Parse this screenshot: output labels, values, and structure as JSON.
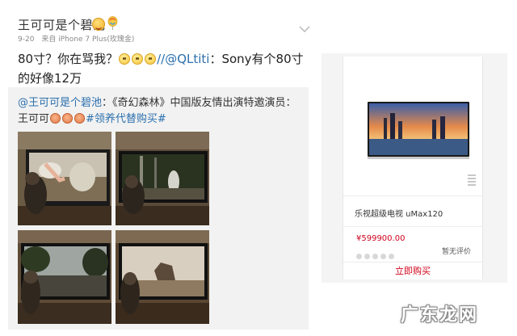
{
  "post": {
    "author": "王可可是个碧池",
    "time": "9-20",
    "source": "来自 iPhone 7 Plus(玫瑰金)",
    "text_before": "80寸？你在骂我？",
    "text_mention": "//@QLtiti",
    "text_after": "：Sony有个80寸的好像12万",
    "quote": {
      "mention": "@王可可是个碧池",
      "text": "：《奇幻森林》中国版友情出演特邀演员：王可可",
      "tag": "#领养代替购买#"
    },
    "thumbnails": [
      {
        "name": "thumb-dog-watching-tv-1"
      },
      {
        "name": "thumb-dog-watching-tv-2"
      },
      {
        "name": "thumb-dog-watching-tv-3"
      },
      {
        "name": "thumb-dog-watching-tv-4"
      }
    ]
  },
  "product": {
    "name": "乐视超级电视 uMax120",
    "price": "¥599900.00",
    "rating_text": "暂无评价",
    "rating_stars": 0,
    "buy_label": "立即购买",
    "icon": "tv-product-image"
  },
  "watermark": "广东龙网",
  "colors": {
    "mention": "#2b6fad",
    "price": "#d0021b",
    "quote_bg": "#f2f2f2"
  }
}
